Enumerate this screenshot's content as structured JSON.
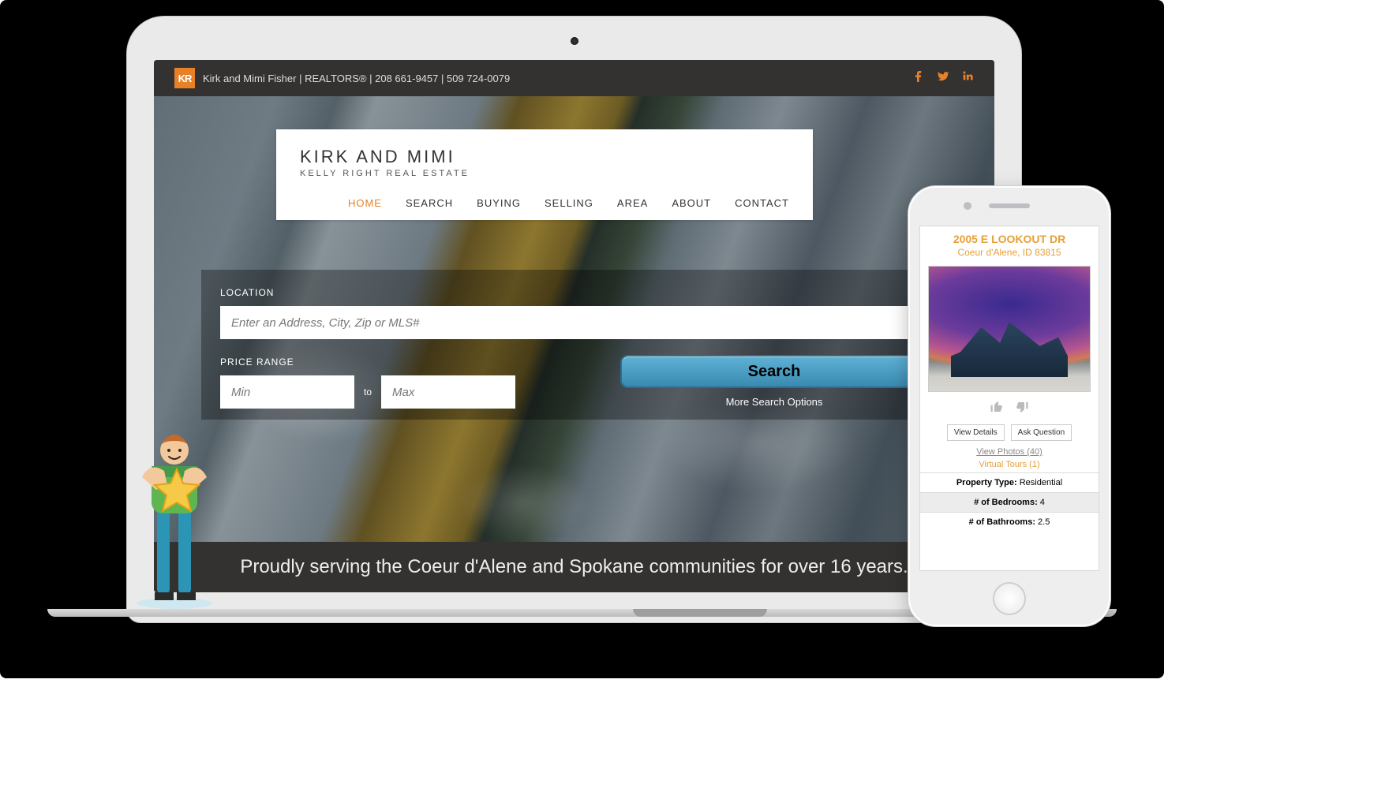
{
  "topbar": {
    "brand_initials": "KR",
    "text": "Kirk and Mimi Fisher | REALTORS® | 208 661-9457 | 509 724-0079",
    "socials": [
      "facebook-icon",
      "twitter-icon",
      "linkedin-icon"
    ]
  },
  "nav": {
    "title": "KIRK AND MIMI",
    "subtitle": "KELLY RIGHT REAL ESTATE",
    "items": [
      "HOME",
      "SEARCH",
      "BUYING",
      "SELLING",
      "AREA",
      "ABOUT",
      "CONTACT"
    ],
    "active_index": 0
  },
  "search": {
    "location_label": "LOCATION",
    "location_placeholder": "Enter an Address, City, Zip or MLS#",
    "price_label": "PRICE RANGE",
    "min_placeholder": "Min",
    "to_label": "to",
    "max_placeholder": "Max",
    "button_label": "Search",
    "more_label": "More Search Options"
  },
  "footer": {
    "tagline": "Proudly serving the Coeur d'Alene and Spokane communities for over 16 years."
  },
  "listing": {
    "address": "2005 E LOOKOUT DR",
    "citystate": "Coeur d'Alene, ID 83815",
    "view_details": "View Details",
    "ask_question": "Ask Question",
    "view_photos": "View Photos (40)",
    "virtual_tours": "Virtual Tours (1)",
    "specs": [
      {
        "label": "Property Type:",
        "value": " Residential"
      },
      {
        "label": "# of Bedrooms:",
        "value": " 4"
      },
      {
        "label": "# of Bathrooms:",
        "value": " 2.5"
      }
    ]
  },
  "colors": {
    "accent": "#e88028",
    "listing_link": "#e6a038"
  }
}
